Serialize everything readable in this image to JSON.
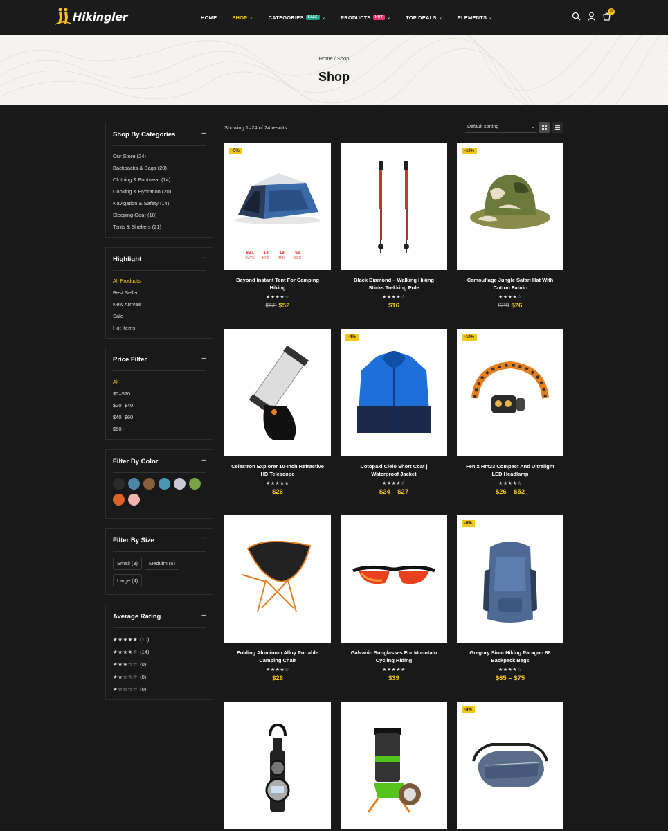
{
  "header": {
    "brand": "Hikingler",
    "nav": [
      {
        "label": "HOME",
        "active": false,
        "dropdown": false,
        "tag": ""
      },
      {
        "label": "SHOP",
        "active": true,
        "dropdown": true,
        "tag": ""
      },
      {
        "label": "CATEGORIES",
        "active": false,
        "dropdown": true,
        "tag": "SALE"
      },
      {
        "label": "PRODUCTS",
        "active": false,
        "dropdown": true,
        "tag": "HOT"
      },
      {
        "label": "TOP DEALS",
        "active": false,
        "dropdown": true,
        "tag": ""
      },
      {
        "label": "ELEMENTS",
        "active": false,
        "dropdown": true,
        "tag": ""
      }
    ],
    "cart_count": "0",
    "icons": [
      "search-icon",
      "user-icon",
      "cart-icon"
    ]
  },
  "banner": {
    "breadcrumb": "Home / Shop",
    "title": "Shop"
  },
  "sidebar": {
    "categories": {
      "title": "Shop By Categories",
      "items": [
        "Our Store (24)",
        "Backpacks & Bags (20)",
        "Clothing & Footwear (14)",
        "Cooking & Hydration (20)",
        "Navigation & Safety (14)",
        "Sleeping Gear (18)",
        "Tents & Shelters (21)"
      ]
    },
    "highlight": {
      "title": "Highlight",
      "items": [
        "All Products",
        "Best Seller",
        "New Arrivals",
        "Sale",
        "Hot Items"
      ]
    },
    "price": {
      "title": "Price Filter",
      "items": [
        "All",
        "$0–$20",
        "$20–$40",
        "$40–$60",
        "$60+"
      ]
    },
    "color": {
      "title": "Filter By Color",
      "colors": [
        "#2b2b2b",
        "#4c87a8",
        "#8a5e3a",
        "#4b98b5",
        "#c9c9d6",
        "#7aa346",
        "#e0622b",
        "#f0b4b0"
      ]
    },
    "size": {
      "title": "Filter By Size",
      "items": [
        "Small (3)",
        "Meduim (5)",
        "Large (4)"
      ]
    },
    "rating": {
      "title": "Average Rating",
      "items": [
        {
          "stars": 5,
          "count": "(10)"
        },
        {
          "stars": 4,
          "count": "(14)"
        },
        {
          "stars": 3,
          "count": "(0)"
        },
        {
          "stars": 2,
          "count": "(0)"
        },
        {
          "stars": 1,
          "count": "(0)"
        }
      ]
    }
  },
  "toolbar": {
    "results": "Showing 1–24 of 24 results",
    "sorting": "Default sorting"
  },
  "products": [
    {
      "name": "Beyond Instant Tent For Camping Hiking",
      "badge": "-5%",
      "rating": 4,
      "old_price": "$55",
      "price": "$52",
      "countdown": [
        {
          "num": "831",
          "label": "DAYS"
        },
        {
          "num": "14",
          "label": "HRS"
        },
        {
          "num": "18",
          "label": "MIN"
        },
        {
          "num": "55",
          "label": "SEC"
        }
      ]
    },
    {
      "name": "Black Diamond – Walking Hiking Sticks Trekking Pole",
      "badge": "",
      "rating": 4,
      "old_price": "",
      "price": "$16"
    },
    {
      "name": "Camouflage Jungle Safari Hat With Cotton Fabric",
      "badge": "-10%",
      "rating": 4,
      "old_price": "$29",
      "price": "$26"
    },
    {
      "name": "Celestron Explorer 10-Inch Refractive HD Telescope",
      "badge": "",
      "rating": 5,
      "old_price": "",
      "price": "$26"
    },
    {
      "name": "Cotopaxi Cielo Short Coat | Waterproof Jacket",
      "badge": "-4%",
      "rating": 4,
      "old_price": "",
      "price": "$24 – $27"
    },
    {
      "name": "Fenix Hm23 Compact And Ultralight LED Headlamp",
      "badge": "-10%",
      "rating": 4,
      "old_price": "",
      "price": "$26 – $52"
    },
    {
      "name": "Folding Aluminum Alloy Portable Camping Chair",
      "badge": "",
      "rating": 4,
      "old_price": "",
      "price": "$28"
    },
    {
      "name": "Galvanic Sunglasses For Mountain Cycling Riding",
      "badge": "",
      "rating": 5,
      "old_price": "",
      "price": "$39"
    },
    {
      "name": "Gregory Sirac Hiking Paragon 68 Backpack Bags",
      "badge": "-6%",
      "rating": 4,
      "old_price": "",
      "price": "$65 – $75"
    },
    {
      "name": "",
      "badge": "",
      "rating": 0,
      "old_price": "",
      "price": ""
    },
    {
      "name": "",
      "badge": "",
      "rating": 0,
      "old_price": "",
      "price": ""
    },
    {
      "name": "",
      "badge": "-8%",
      "rating": 0,
      "old_price": "",
      "price": ""
    }
  ]
}
